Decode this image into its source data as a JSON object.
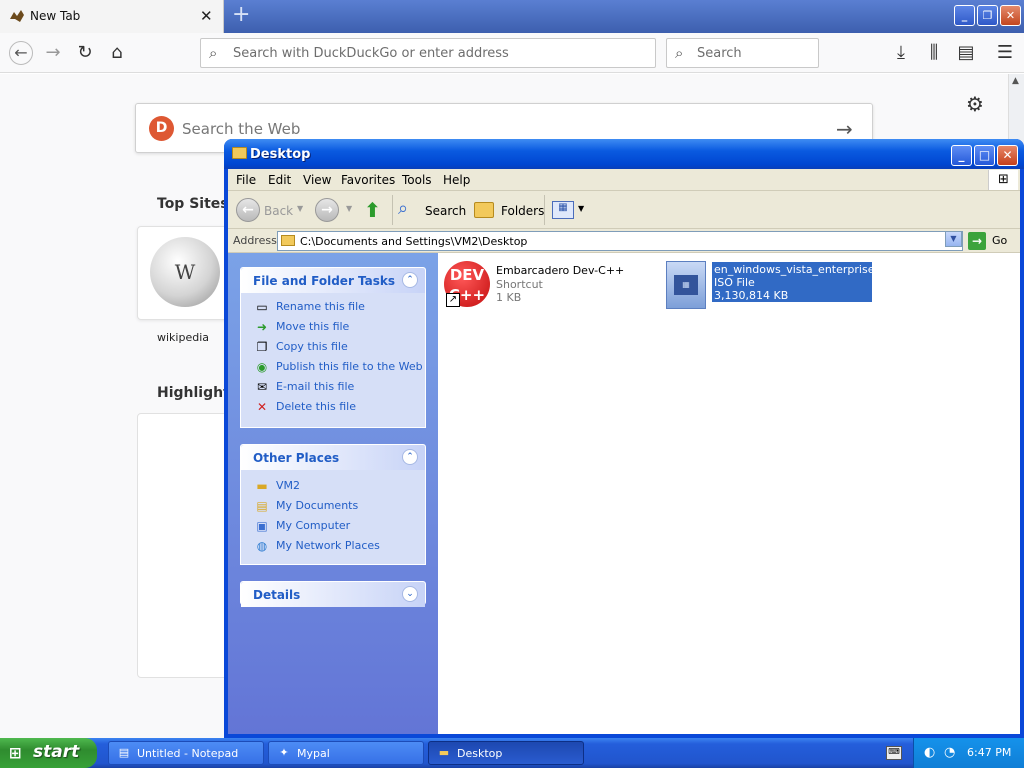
{
  "firefox": {
    "tab_title": "New Tab",
    "url_placeholder": "Search with DuckDuckGo or enter address",
    "search_placeholder": "Search",
    "web_search_placeholder": "Search the Web",
    "top_sites_title": "Top Sites",
    "top_site_label": "wikipedia",
    "highlights_title": "Highlights"
  },
  "explorer": {
    "title": "Desktop",
    "menu": [
      "File",
      "Edit",
      "View",
      "Favorites",
      "Tools",
      "Help"
    ],
    "toolbar": {
      "back": "Back",
      "search": "Search",
      "folders": "Folders"
    },
    "address_label": "Address",
    "address_value": "C:\\Documents and Settings\\VM2\\Desktop",
    "go_label": "Go",
    "file_tasks": {
      "title": "File and Folder Tasks",
      "items": [
        "Rename this file",
        "Move this file",
        "Copy this file",
        "Publish this file to the Web",
        "E-mail this file",
        "Delete this file"
      ]
    },
    "other_places": {
      "title": "Other Places",
      "items": [
        "VM2",
        "My Documents",
        "My Computer",
        "My Network Places"
      ]
    },
    "details_title": "Details",
    "files": [
      {
        "name": "Embarcadero Dev-C++",
        "type": "Shortcut",
        "size": "1 KB",
        "icon_text": "DEV C++"
      },
      {
        "name": "en_windows_vista_enterprise...",
        "type": "ISO File",
        "size": "3,130,814 KB"
      }
    ]
  },
  "taskbar": {
    "start_label": "start",
    "tasks": [
      "Untitled - Notepad",
      "Mypal",
      "Desktop"
    ],
    "clock": "6:47 PM"
  },
  "colors": {
    "xp_blue": "#0a48d8",
    "selection": "#316ac5",
    "task_link": "#215dc6",
    "start_green": "#37a137"
  }
}
